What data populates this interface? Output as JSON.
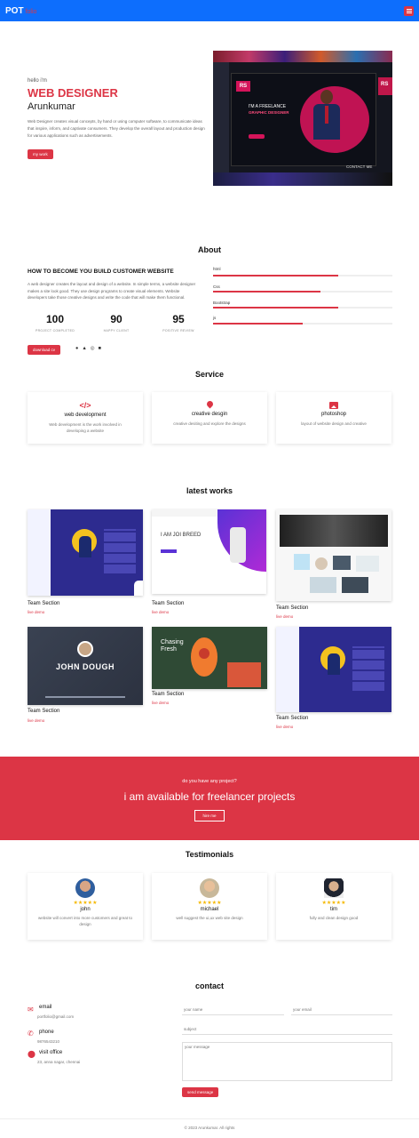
{
  "nav": {
    "brand": "POT",
    "brand_suffix": "folio"
  },
  "hero": {
    "hello": "hello i'm",
    "role": "WEB DESIGNER",
    "name": "Arunkumar",
    "desc": "Web Designer creates visual concepts, by hand or using computer software, to communicate ideas that inspire, inform, and captivate consumers. They develop the overall layout and production design for various applications such as advertisements.",
    "button": "my work",
    "screen_logo": "RS",
    "screen_headline1": "I'M A FREELANCE",
    "screen_headline2": "GRAPHIC DESIGNER",
    "screen_footer": "CONTACT ME"
  },
  "about": {
    "title": "About",
    "subtitle": "HOW TO BECOME YOU BUILD CUSTOMER WEBSITE",
    "desc": "A web designer creates the layout and design of a website. In simple terms, a website designer makes a site look good. They use design programs to create visual elements. Website developers take those creative designs and write the code that will make them functional.",
    "stats": [
      {
        "num": "100",
        "label": "PROJECT COMPLETED"
      },
      {
        "num": "90",
        "label": "HAPPY CLIENT"
      },
      {
        "num": "95",
        "label": "POSITIVE REVIEW"
      }
    ],
    "download": "download cv",
    "skills": [
      {
        "name": "html",
        "value": 0.7
      },
      {
        "name": "Css",
        "value": 0.6
      },
      {
        "name": "Bootstrap",
        "value": 0.7
      },
      {
        "name": "js",
        "value": 0.5
      }
    ]
  },
  "service": {
    "title": "Service",
    "items": [
      {
        "name": "web development",
        "desc": "Web development is the work involved in developing a website",
        "icon": "code-icon"
      },
      {
        "name": "creative desgin",
        "desc": "creative desiting and explore the designs",
        "icon": "pin-icon"
      },
      {
        "name": "photoshop",
        "desc": "layout of website design and creative",
        "icon": "image-icon"
      }
    ]
  },
  "works": {
    "title": "latest works",
    "items": [
      {
        "title": "Team Section",
        "link": "live demo"
      },
      {
        "title": "Team Section",
        "link": "live demo"
      },
      {
        "title": "Team Section",
        "link": "live demo"
      },
      {
        "title": "Team Section",
        "link": "live demo"
      },
      {
        "title": "Team Section",
        "link": "live demo"
      },
      {
        "title": "Team Section",
        "link": "live demo"
      }
    ],
    "john": "JOHN DOUGH",
    "chasing": "Chasing Fresh"
  },
  "cta": {
    "question": "do you have any project?",
    "headline": "i am available for freelancer projects",
    "button": "hire me"
  },
  "testimonials": {
    "title": "Testimonials",
    "items": [
      {
        "name": "john",
        "text": "website will convert into more customers and great to design"
      },
      {
        "name": "michael",
        "text": "well suggest the ui,ux web site design"
      },
      {
        "name": "tim",
        "text": "fully and clean design good"
      }
    ]
  },
  "contact": {
    "title": "contact",
    "email_label": "email",
    "email_value": "portfolio@gmail.com",
    "phone_label": "phone",
    "phone_value": "9876543210",
    "office_label": "visit office",
    "office_value": "23, anna nagar, chennai",
    "ph_name": "your name",
    "ph_email": "your email",
    "ph_subject": "subject",
    "ph_message": "your message",
    "send": "send message"
  },
  "footer": {
    "text": "© 2023 Arunkumar. All rights"
  },
  "colors": {
    "accent": "#dc3545",
    "nav": "#0d6efd"
  }
}
